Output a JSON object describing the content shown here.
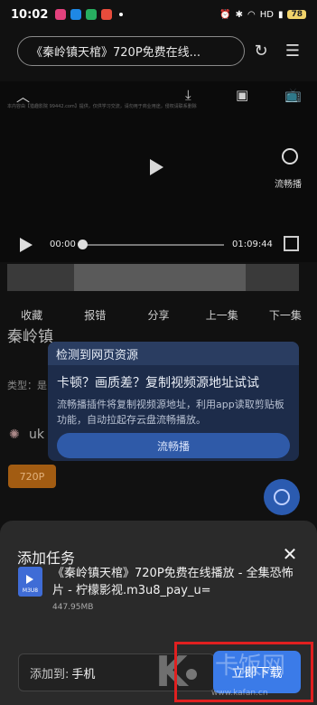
{
  "status_bar": {
    "time": "10:02",
    "battery": "78",
    "app_icon_colors": [
      "#e3417d",
      "#1e88e5",
      "#27ae60",
      "#e74c3c"
    ],
    "indicators": [
      "alarm-icon",
      "bluetooth-icon",
      "wifi-icon",
      "HD",
      "signal-icon"
    ]
  },
  "address_bar": {
    "url_text": "《秦岭镇天棺》720P免费在线..."
  },
  "player": {
    "current_time": "00:00",
    "total_time": "01:09:44",
    "progress": 0,
    "liuchang_label": "流畅播",
    "tiny_text": "本内容由【猎趣影院 99442.com】提供，仅供学习交流，请勿用于商业用途，侵权请联系删除"
  },
  "actions": [
    "收藏",
    "报错",
    "分享",
    "上一集",
    "下一集"
  ],
  "page_background": {
    "title_partial": "秦岭镇",
    "type_partial": "类型：是",
    "line_partial": "uk",
    "quality_badge": "720P"
  },
  "resource_popup": {
    "header": "检测到网页资源",
    "title": "卡顿？画质差？复制视频源地址试试",
    "body": "流畅播插件将复制视频源地址，利用app读取剪贴板功能，自动拉起存云盘流畅播放。",
    "button": "流畅播"
  },
  "add_task_sheet": {
    "title": "添加任务",
    "file_icon_label": "M3U8",
    "file_name": "《秦岭镇天棺》720P免费在线播放 - 全集恐怖片 - 柠檬影视.m3u8_pay_u=",
    "file_size": "447.95MB",
    "target_label": "添加到:",
    "target_value": "手机",
    "download_button": "立即下载"
  },
  "watermark": {
    "name": "卡饭网",
    "url": "www.kafan.cn"
  },
  "colors": {
    "accent_blue": "#3b7be8",
    "highlight_red": "#e02020"
  }
}
